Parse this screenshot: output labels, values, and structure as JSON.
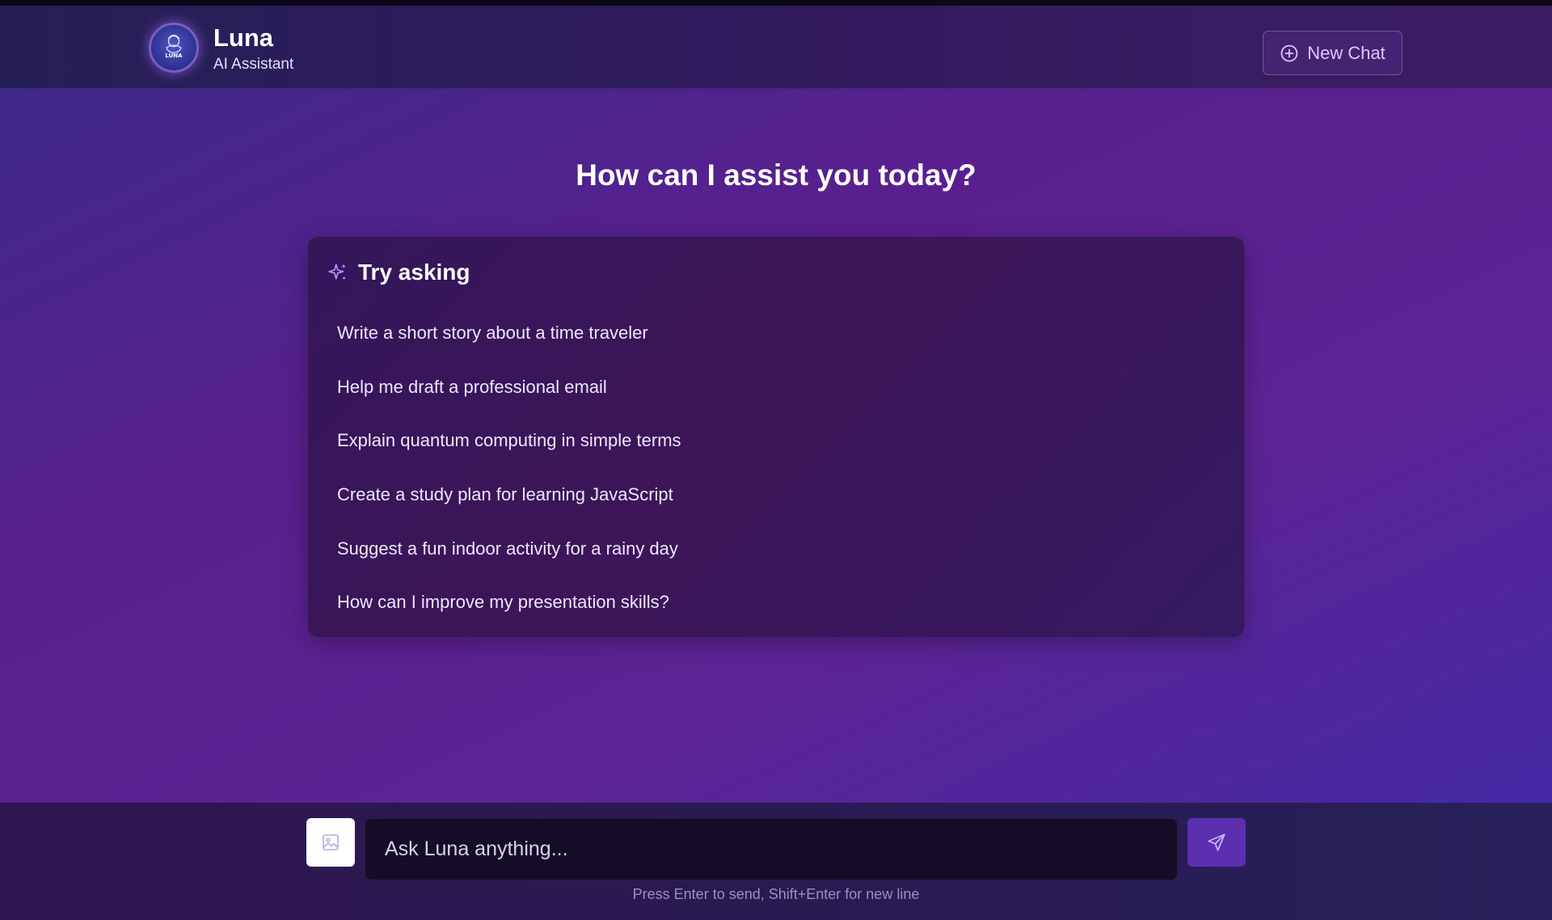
{
  "app": {
    "name": "Luna",
    "subtitle": "AI Assistant",
    "logo_text": "LUNA"
  },
  "header": {
    "new_chat_label": "New Chat",
    "new_chat_icon": "plus-circle-icon"
  },
  "main": {
    "heading": "How can I assist you today?",
    "card": {
      "title": "Try asking",
      "icon": "sparkles-icon",
      "suggestions": [
        "Write a short story about a time traveler",
        "Help me draft a professional email",
        "Explain quantum computing in simple terms",
        "Create a study plan for learning JavaScript",
        "Suggest a fun indoor activity for a rainy day",
        "How can I improve my presentation skills?"
      ]
    }
  },
  "composer": {
    "placeholder": "Ask Luna anything...",
    "value": "",
    "image_icon": "image-icon",
    "send_icon": "send-icon",
    "hint": "Press Enter to send, Shift+Enter for new line"
  },
  "colors": {
    "accent": "#5b2fb0",
    "sparkle": "#c08aff",
    "new_chat_text": "#ddc7ff"
  }
}
